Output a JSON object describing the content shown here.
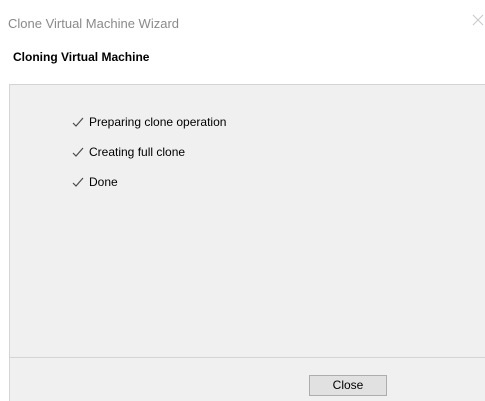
{
  "window": {
    "title": "Clone Virtual Machine Wizard",
    "subtitle": "Cloning Virtual Machine"
  },
  "steps": [
    {
      "label": "Preparing clone operation",
      "status": "done",
      "icon": "checkmark-icon"
    },
    {
      "label": "Creating full clone",
      "status": "done",
      "icon": "checkmark-icon"
    },
    {
      "label": "Done",
      "status": "done",
      "icon": "checkmark-icon"
    }
  ],
  "footer": {
    "close_label": "Close"
  },
  "colors": {
    "title_text": "#8a8a8a",
    "content_bg": "#f0f0f0",
    "divider": "#d4d4d4",
    "check": "#4a4a4a",
    "button_bg": "#e1e1e1",
    "button_border": "#adadad"
  }
}
